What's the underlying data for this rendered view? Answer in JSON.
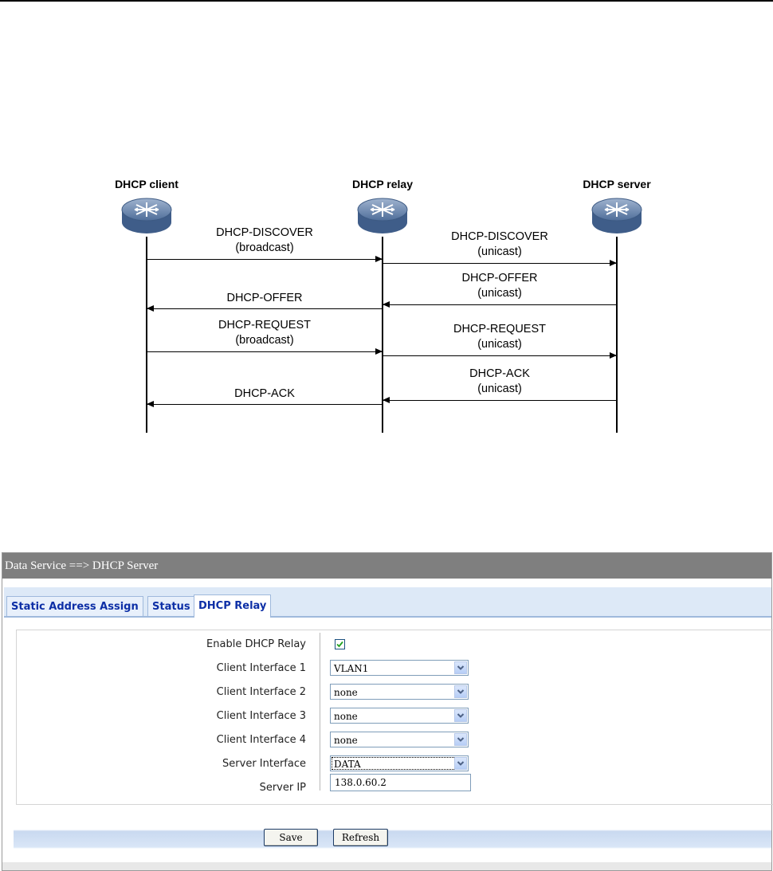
{
  "diagram": {
    "nodes": [
      {
        "id": "client",
        "title": "DHCP client"
      },
      {
        "id": "relay",
        "title": "DHCP relay"
      },
      {
        "id": "server",
        "title": "DHCP server"
      }
    ],
    "messages": [
      {
        "from": "client",
        "to": "relay",
        "line1": "DHCP-DISCOVER",
        "line2": "(broadcast)"
      },
      {
        "from": "relay",
        "to": "server",
        "line1": "DHCP-DISCOVER",
        "line2": "(unicast)"
      },
      {
        "from": "server",
        "to": "relay",
        "line1": "DHCP-OFFER",
        "line2": "(unicast)"
      },
      {
        "from": "relay",
        "to": "client",
        "line1": "DHCP-OFFER",
        "line2": ""
      },
      {
        "from": "client",
        "to": "relay",
        "line1": "DHCP-REQUEST",
        "line2": "(broadcast)"
      },
      {
        "from": "relay",
        "to": "server",
        "line1": "DHCP-REQUEST",
        "line2": "(unicast)"
      },
      {
        "from": "server",
        "to": "relay",
        "line1": "DHCP-ACK",
        "line2": "(unicast)"
      },
      {
        "from": "relay",
        "to": "client",
        "line1": "DHCP-ACK",
        "line2": ""
      }
    ]
  },
  "panel": {
    "breadcrumb": "Data Service ==> DHCP Server",
    "tabs": [
      {
        "label": "Static Address Assign",
        "active": false
      },
      {
        "label": "Status",
        "active": false
      },
      {
        "label": "DHCP Relay",
        "active": true
      }
    ],
    "form": {
      "enable_label": "Enable DHCP Relay",
      "enable_checked": true,
      "client1_label": "Client Interface 1",
      "client1_value": "VLAN1",
      "client2_label": "Client Interface 2",
      "client2_value": "none",
      "client3_label": "Client Interface 3",
      "client3_value": "none",
      "client4_label": "Client Interface 4",
      "client4_value": "none",
      "server_if_label": "Server Interface",
      "server_if_value": "DATA",
      "server_ip_label": "Server IP",
      "server_ip_value": "138.0.60.2"
    },
    "buttons": {
      "save": "Save",
      "refresh": "Refresh"
    }
  },
  "colors": {
    "tab_text": "#0d2fa6",
    "title_bar": "#7f7f7f",
    "tab_strip": "#dde9f7"
  }
}
